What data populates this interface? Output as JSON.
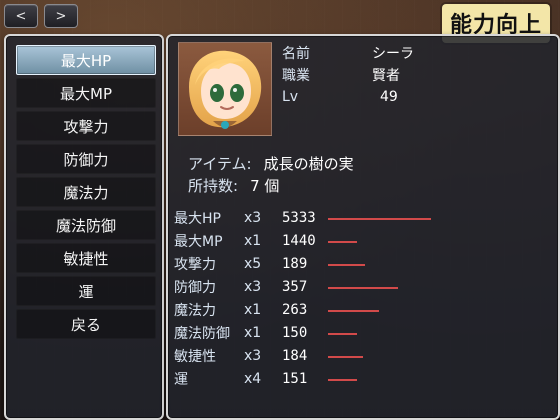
{
  "ui": {
    "nav": {
      "prev_symbol": "<",
      "next_symbol": ">"
    },
    "title_badge": "能力向上",
    "commands": [
      {
        "label": "最大HP",
        "selected": true
      },
      {
        "label": "最大MP",
        "selected": false
      },
      {
        "label": "攻撃力",
        "selected": false
      },
      {
        "label": "防御力",
        "selected": false
      },
      {
        "label": "魔法力",
        "selected": false
      },
      {
        "label": "魔法防御",
        "selected": false
      },
      {
        "label": "敏捷性",
        "selected": false
      },
      {
        "label": "運",
        "selected": false
      },
      {
        "label": "戻る",
        "selected": false
      }
    ],
    "character": {
      "name_label": "名前",
      "name_value": "シーラ",
      "job_label": "職業",
      "job_value": "賢者",
      "lv_label": "Lv",
      "lv_value": "49"
    },
    "item": {
      "item_label": "アイテム:",
      "item_value": "成長の樹の実",
      "owned_label": "所持数:",
      "owned_value": "7 個"
    },
    "stats": [
      {
        "name": "最大HP",
        "mult": "x3",
        "value": "5333",
        "bar_fill": 0.47
      },
      {
        "name": "最大MP",
        "mult": "x1",
        "value": "1440",
        "bar_fill": 0.13
      },
      {
        "name": "攻撃力",
        "mult": "x5",
        "value": "189",
        "bar_fill": 0.17
      },
      {
        "name": "防御力",
        "mult": "x3",
        "value": "357",
        "bar_fill": 0.32
      },
      {
        "name": "魔法力",
        "mult": "x1",
        "value": "263",
        "bar_fill": 0.23
      },
      {
        "name": "魔法防御",
        "mult": "x1",
        "value": "150",
        "bar_fill": 0.13
      },
      {
        "name": "敏捷性",
        "mult": "x3",
        "value": "184",
        "bar_fill": 0.16
      },
      {
        "name": "運",
        "mult": "x4",
        "value": "151",
        "bar_fill": 0.13
      }
    ]
  }
}
